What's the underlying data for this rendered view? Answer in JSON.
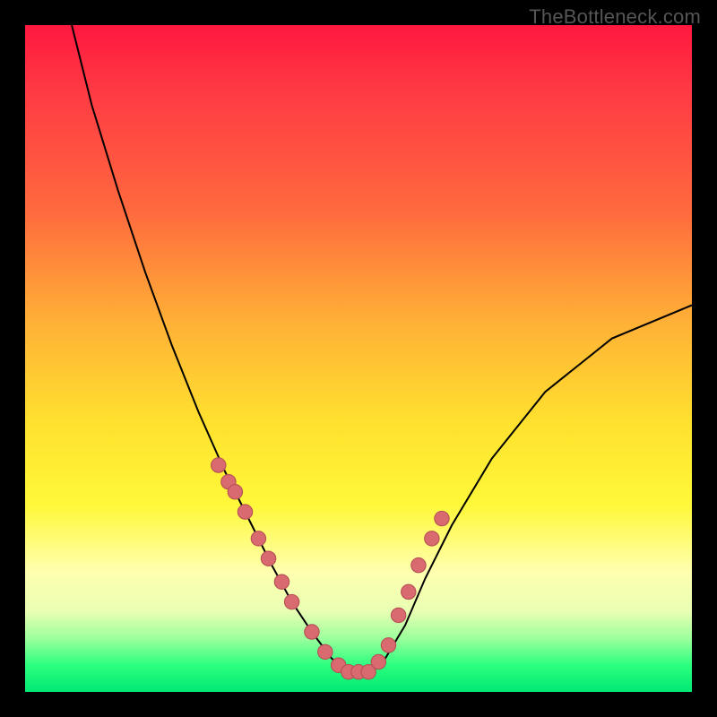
{
  "watermark": "TheBottleneck.com",
  "colors": {
    "black": "#000000",
    "curve": "#000000",
    "dot": "#d96a6f",
    "dot_stroke": "#b55055",
    "gradient_top": "#ff183f",
    "gradient_bottom": "#00e873"
  },
  "chart_data": {
    "type": "line",
    "title": "",
    "xlabel": "",
    "ylabel": "",
    "xlim": [
      0,
      100
    ],
    "ylim": [
      0,
      100
    ],
    "grid": false,
    "legend": false,
    "annotations": [
      "TheBottleneck.com"
    ],
    "description": "Asymmetric V-shaped bottleneck curve over a vertical heat gradient; minimum lies in the green band near the bottom. Pink dots highlight segments on both flanks near and across the minimum.",
    "series": [
      {
        "name": "bottleneck-curve",
        "x": [
          7,
          10,
          14,
          18,
          22,
          26,
          30,
          34,
          37,
          40,
          43,
          46,
          48.5,
          51.5,
          54,
          57,
          60,
          64,
          70,
          78,
          88,
          100
        ],
        "y": [
          100,
          88,
          75,
          63,
          52,
          42,
          33,
          25,
          19,
          13.5,
          9,
          5,
          3,
          3,
          5,
          10,
          17,
          25,
          35,
          45,
          53,
          58
        ]
      },
      {
        "name": "highlight-dots",
        "x": [
          29,
          30.5,
          31.5,
          33,
          35,
          36.5,
          38.5,
          40,
          43,
          45,
          47,
          48.5,
          50,
          51.5,
          53,
          54.5,
          56,
          57.5,
          59,
          61,
          62.5
        ],
        "y": [
          34,
          31.5,
          30,
          27,
          23,
          20,
          16.5,
          13.5,
          9,
          6,
          4,
          3,
          3,
          3,
          4.5,
          7,
          11.5,
          15,
          19,
          23,
          26
        ]
      }
    ]
  }
}
